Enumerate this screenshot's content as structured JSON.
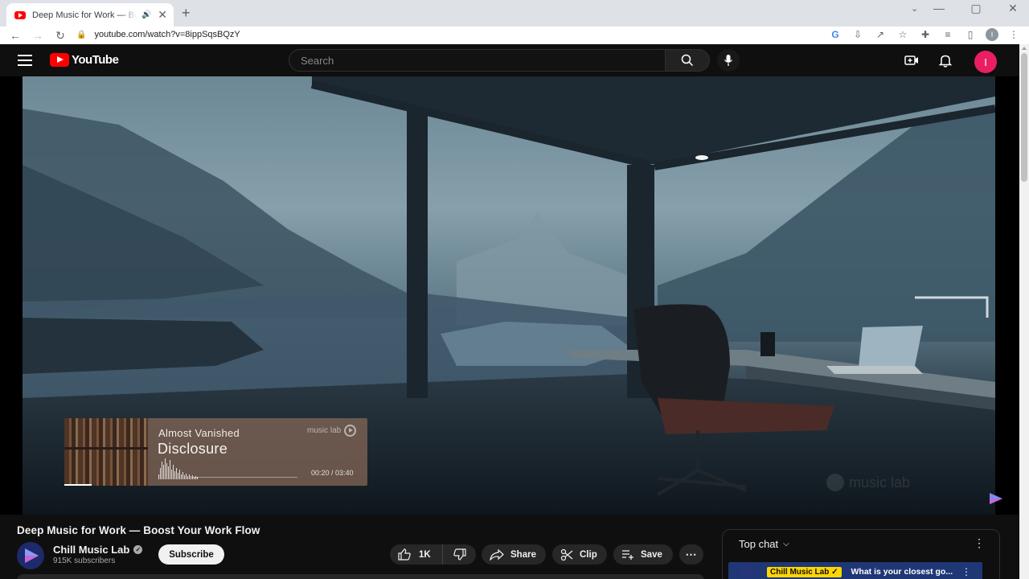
{
  "browser": {
    "tab": {
      "title": "Deep Music for Work — Boost Your Work Flow"
    },
    "url": "youtube.com/watch?v=8ippSqsBQzY",
    "profile_initial": "I"
  },
  "masthead": {
    "logo_text": "YouTube",
    "search_placeholder": "Search",
    "avatar_initial": "I"
  },
  "player": {
    "now_playing": {
      "artist": "Almost Vanished",
      "track": "Disclosure",
      "brand": "music lab",
      "time": "00:20 / 03:40",
      "progress": 0.09
    },
    "watermark": "music lab"
  },
  "video": {
    "title": "Deep Music for Work — Boost Your Work Flow",
    "channel": {
      "name": "Chill Music Lab",
      "subscribers": "915K subscribers",
      "verified": true
    },
    "actions": {
      "subscribe": "Subscribe",
      "likes": "1K",
      "share": "Share",
      "clip": "Clip",
      "save": "Save"
    }
  },
  "chat": {
    "header": "Top chat",
    "pinned": {
      "author": "Chill Music Lab",
      "message": "What is your closest go..."
    }
  },
  "colors": {
    "youtube_red": "#ff0000",
    "masthead_bg": "#0f0f0f",
    "pill_bg": "#272727",
    "avatar": "#e91e63",
    "pinned_chat_bg": "#1f3775",
    "author_badge": "#ffd600"
  }
}
